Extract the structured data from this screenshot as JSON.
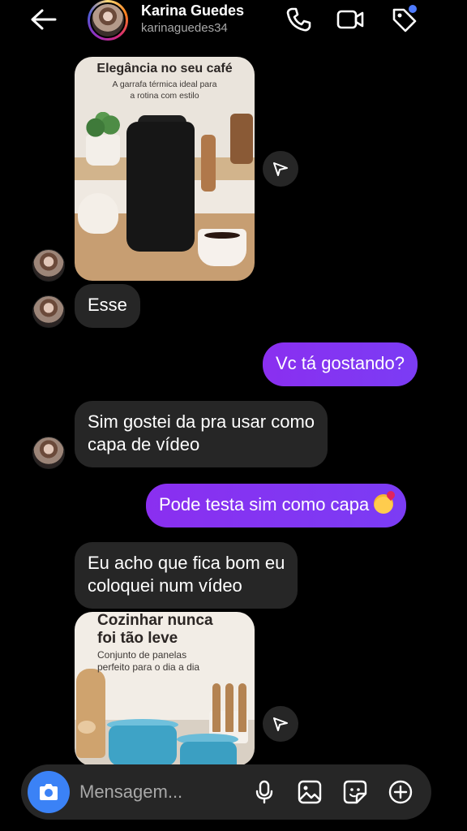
{
  "header": {
    "name": "Karina Guedes",
    "username": "karinaguedes34"
  },
  "cards": [
    {
      "title": "Elegância no seu café",
      "subtitle_line1": "A garrafa térmica ideal para",
      "subtitle_line2": "a rotina com estilo"
    },
    {
      "title_line1": "Cozinhar nunca",
      "title_line2": "foi tão leve",
      "subtitle_line1": "Conjunto de panelas",
      "subtitle_line2": "perfeito para o dia a dia"
    }
  ],
  "messages": [
    {
      "direction": "in",
      "text": "Esse"
    },
    {
      "direction": "out",
      "text": "Vc tá gostando?"
    },
    {
      "direction": "in",
      "line1": "Sim gostei da pra usar como",
      "line2": "capa de vídeo"
    },
    {
      "direction": "out",
      "text": "Pode testa sim como capa"
    },
    {
      "direction": "in",
      "line1": "Eu acho que fica bom eu",
      "line2": "coloquei num vídeo"
    }
  ],
  "composer": {
    "placeholder": "Mensagem..."
  },
  "colors": {
    "outgoing_bubble": "#7b3cf4",
    "incoming_bubble": "#262626",
    "camera_button": "#3b82f6",
    "background": "#000000"
  }
}
